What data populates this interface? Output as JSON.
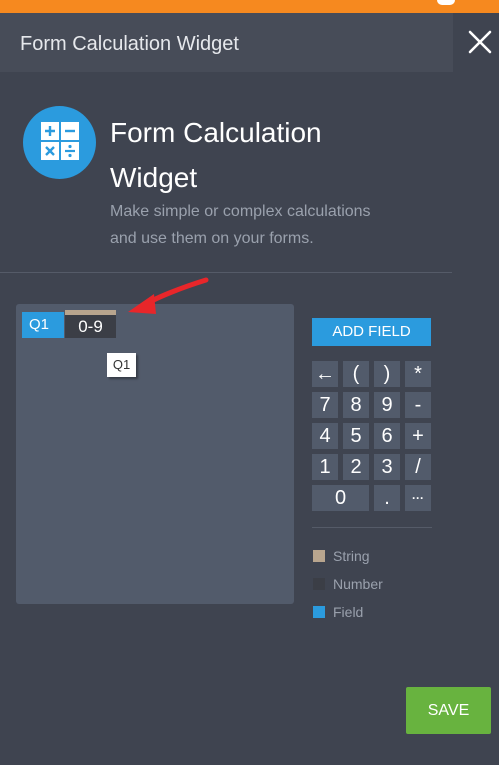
{
  "header": {
    "title": "Form Calculation Widget",
    "close_label": "×"
  },
  "widget": {
    "name_line1": "Form Calculation",
    "name_line2": "Widget",
    "desc_line1": "Make simple or complex calculations",
    "desc_line2": "and use them on your forms."
  },
  "editor": {
    "field_token": "Q1",
    "number_token": "0-9",
    "tooltip": "Q1"
  },
  "add_field_label": "ADD FIELD",
  "keypad": [
    {
      "label": "←",
      "name": "backspace-key"
    },
    {
      "label": "(",
      "name": "open-paren-key"
    },
    {
      "label": ")",
      "name": "close-paren-key"
    },
    {
      "label": "*",
      "name": "multiply-key"
    },
    {
      "label": "7",
      "name": "digit-7-key"
    },
    {
      "label": "8",
      "name": "digit-8-key"
    },
    {
      "label": "9",
      "name": "digit-9-key"
    },
    {
      "label": "-",
      "name": "minus-key"
    },
    {
      "label": "4",
      "name": "digit-4-key"
    },
    {
      "label": "5",
      "name": "digit-5-key"
    },
    {
      "label": "6",
      "name": "digit-6-key"
    },
    {
      "label": "+",
      "name": "plus-key"
    },
    {
      "label": "1",
      "name": "digit-1-key"
    },
    {
      "label": "2",
      "name": "digit-2-key"
    },
    {
      "label": "3",
      "name": "digit-3-key"
    },
    {
      "label": "/",
      "name": "divide-key"
    },
    {
      "label": "0",
      "name": "digit-0-key"
    },
    {
      "label": ".",
      "name": "decimal-key"
    },
    {
      "label": "···",
      "name": "more-functions-key"
    }
  ],
  "legend": [
    {
      "label": "String",
      "color": "#b8a58e"
    },
    {
      "label": "Number",
      "color": "#3b3e46"
    },
    {
      "label": "Field",
      "color": "#2b9bde"
    }
  ],
  "save_label": "SAVE",
  "colors": {
    "accent_blue": "#2b9bde",
    "save_green": "#68b33f",
    "top_strip_orange": "#f6891f",
    "arrow_red": "#e8262a"
  }
}
